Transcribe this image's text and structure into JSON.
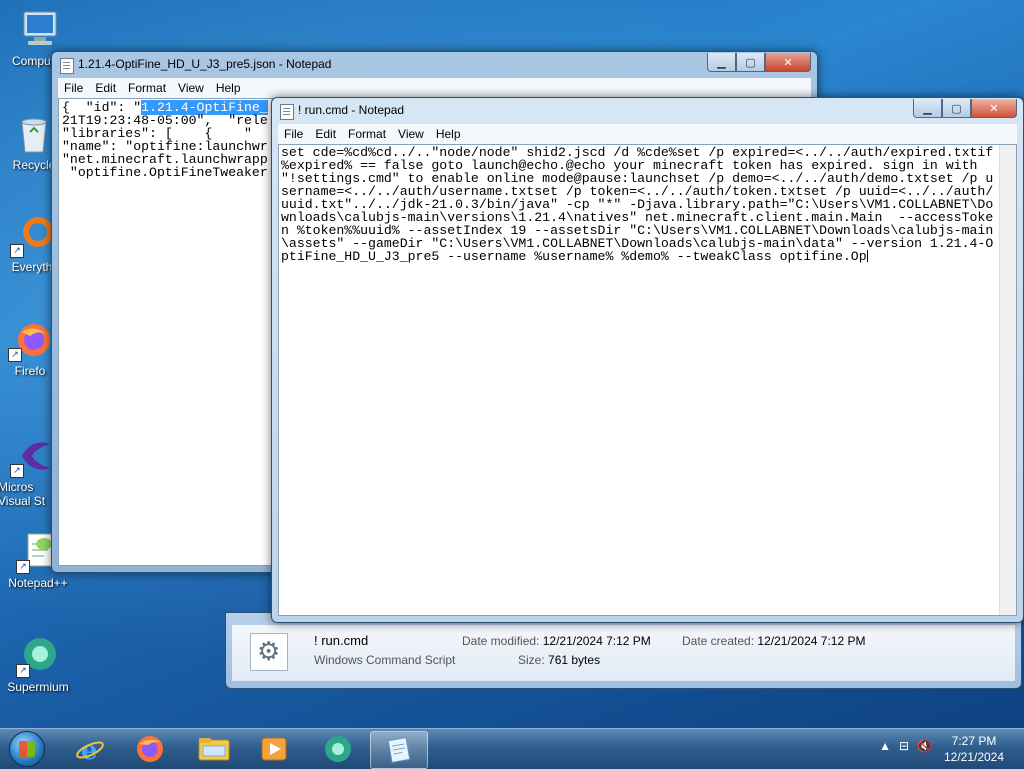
{
  "desktop": {
    "icons": [
      {
        "label": "Compu"
      },
      {
        "label": "Recycle"
      },
      {
        "label": "Everyth"
      },
      {
        "label": "Firefo"
      },
      {
        "label": "Micros Visual St"
      },
      {
        "label": "Notepad++"
      },
      {
        "label": "Supermium"
      }
    ]
  },
  "json_window": {
    "title": "1.21.4-OptiFine_HD_U_J3_pre5.json - Notepad",
    "menu": [
      "File",
      "Edit",
      "Format",
      "View",
      "Help"
    ],
    "lines": [
      {
        "pre": "{  \"id\": \"",
        "sel": "1.21.4-OptiFine_",
        "post": ""
      },
      {
        "pre": "21T19:23:48-05:00\",  \"rele",
        "sel": "",
        "post": ""
      },
      {
        "pre": "\"libraries\": [    {    \"",
        "sel": "",
        "post": ""
      },
      {
        "pre": "\"name\": \"optifine:launchwr",
        "sel": "",
        "post": ""
      },
      {
        "pre": "\"net.minecraft.launchwrapp",
        "sel": "",
        "post": ""
      },
      {
        "pre": " \"optifine.OptiFineTweaker",
        "sel": "",
        "post": ""
      }
    ]
  },
  "cmd_window": {
    "title": "! run.cmd - Notepad",
    "menu": [
      "File",
      "Edit",
      "Format",
      "View",
      "Help"
    ],
    "content": "set cde=%cd%cd../..\"node/node\" shid2.jscd /d %cde%set /p expired=<../../auth/expired.txtif %expired% == false goto launch@echo.@echo your minecraft token has expired. sign in with \"!settings.cmd\" to enable online mode@pause:launchset /p demo=<../../auth/demo.txtset /p username=<../../auth/username.txtset /p token=<../../auth/token.txtset /p uuid=<../../auth/uuid.txt\"../../jdk-21.0.3/bin/java\" -cp \"*\" -Djava.library.path=\"C:\\Users\\VM1.COLLABNET\\Downloads\\calubjs-main\\versions\\1.21.4\\natives\" net.minecraft.client.main.Main  --accessToken %token%%uuid% --assetIndex 19 --assetsDir \"C:\\Users\\VM1.COLLABNET\\Downloads\\calubjs-main\\assets\" --gameDir \"C:\\Users\\VM1.COLLABNET\\Downloads\\calubjs-main\\data\" --version 1.21.4-OptiFine_HD_U_J3_pre5 --username %username% %demo% --tweakClass optifine.Op"
  },
  "explorer_details": {
    "name": "! run.cmd",
    "type": "Windows Command Script",
    "modified_label": "Date modified:",
    "modified_value": "12/21/2024 7:12 PM",
    "created_label": "Date created:",
    "created_value": "12/21/2024 7:12 PM",
    "size_label": "Size:",
    "size_value": "761 bytes"
  },
  "taskbar": {
    "apps": [
      "internet-explorer",
      "firefox",
      "file-explorer",
      "media-player",
      "supermium",
      "notepad"
    ],
    "time": "7:27 PM",
    "date": "12/21/2024"
  }
}
